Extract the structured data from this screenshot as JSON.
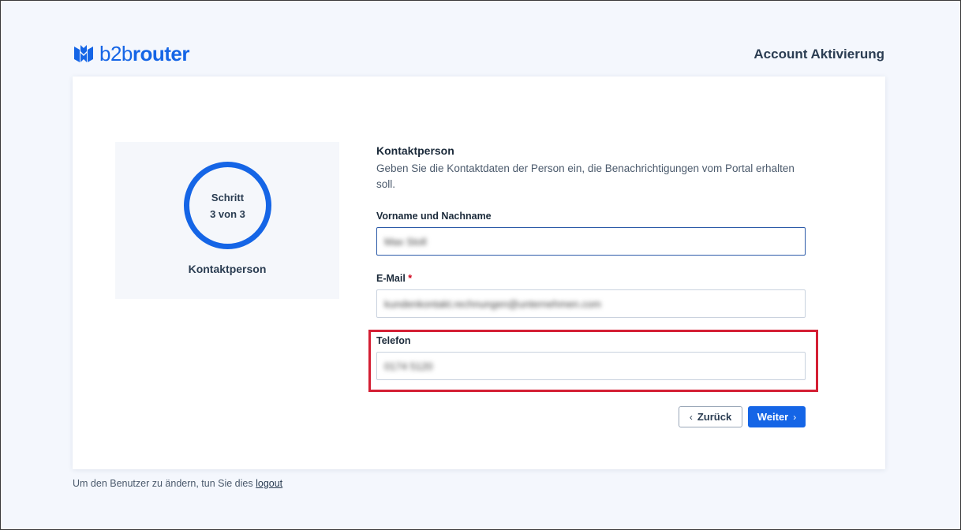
{
  "header": {
    "brand_light": "b2b",
    "brand_bold": "router",
    "page_heading": "Account Aktivierung"
  },
  "step": {
    "word": "Schritt",
    "progress": "3 von 3",
    "label": "Kontaktperson"
  },
  "form": {
    "title": "Kontaktperson",
    "description": "Geben Sie die Kontaktdaten der Person ein, die Benachrichtigungen vom Portal erhalten soll.",
    "name_label": "Vorname und Nachname",
    "name_value": "Max Stoll",
    "email_label": "E-Mail",
    "email_required": "*",
    "email_value": "kundenkontakt.rechnungen@unternehmen.com",
    "phone_label": "Telefon",
    "phone_value": "0174 5120"
  },
  "buttons": {
    "back_label": "Zurück",
    "back_icon": "chevron-left-icon",
    "next_label": "Weiter",
    "next_icon": "chevron-right-icon"
  },
  "footer": {
    "note": "Um den Benutzer zu ändern, tun Sie dies",
    "link": "logout"
  },
  "colors": {
    "accent": "#1565e6",
    "highlight": "#d41f34",
    "background": "#f4f7fd"
  }
}
